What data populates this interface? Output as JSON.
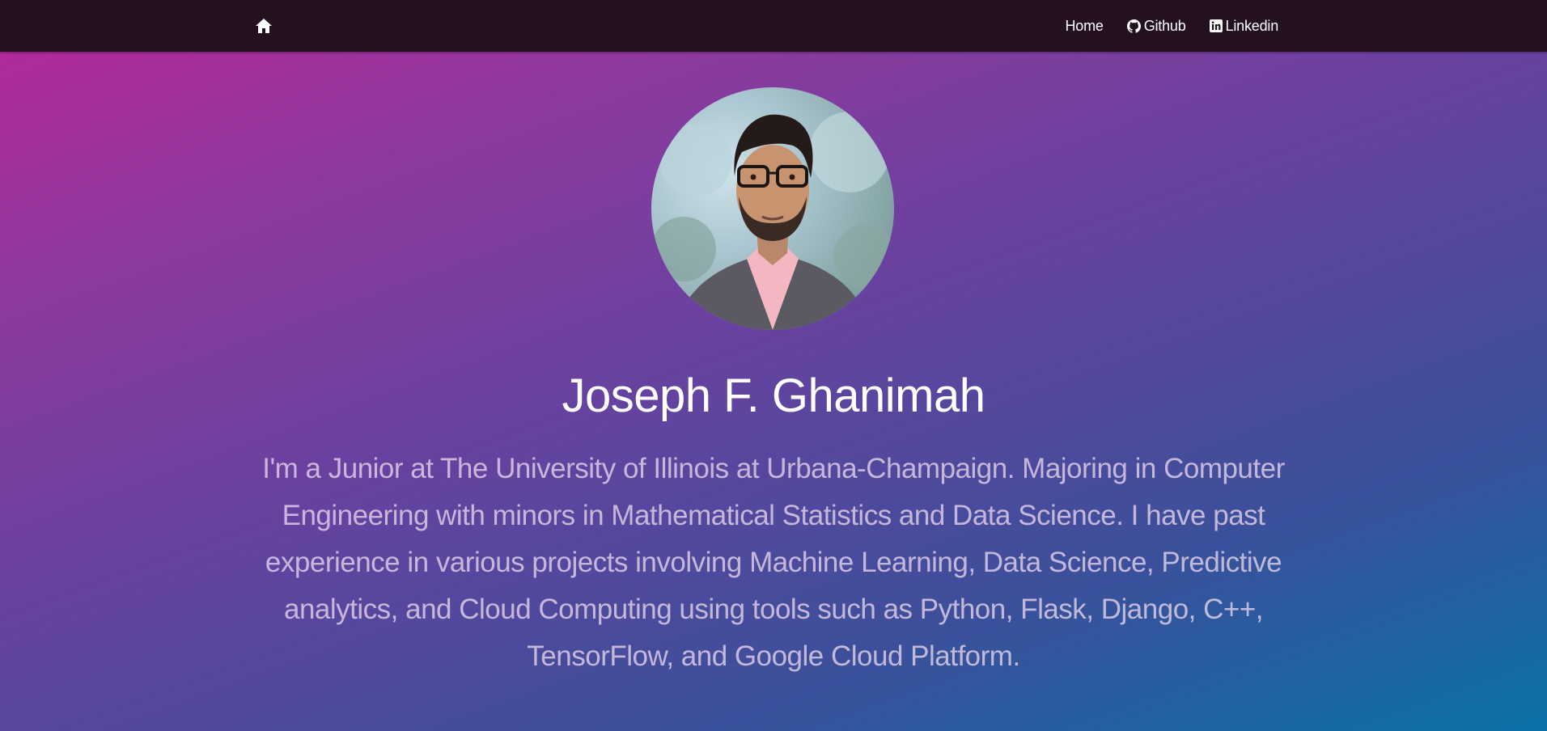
{
  "nav": {
    "home_icon": "home-icon",
    "links": [
      {
        "label": "Home",
        "icon": ""
      },
      {
        "label": "Github",
        "icon": "github-icon"
      },
      {
        "label": "Linkedin",
        "icon": "linkedin-icon"
      }
    ]
  },
  "hero": {
    "name": "Joseph F. Ghanimah",
    "bio": "I'm a Junior at The University of Illinois at Urbana-Champaign. Majoring in Computer Engineering with minors in Mathematical Statistics and Data Science. I have past experience in various projects involving Machine Learning, Data Science, Predictive analytics, and Cloud Computing using tools such as Python, Flask, Django, C++, TensorFlow, and Google Cloud Platform."
  },
  "colors": {
    "navbar": "#231122",
    "gradient_start": "#b8279a",
    "gradient_end": "#0a72a6"
  }
}
